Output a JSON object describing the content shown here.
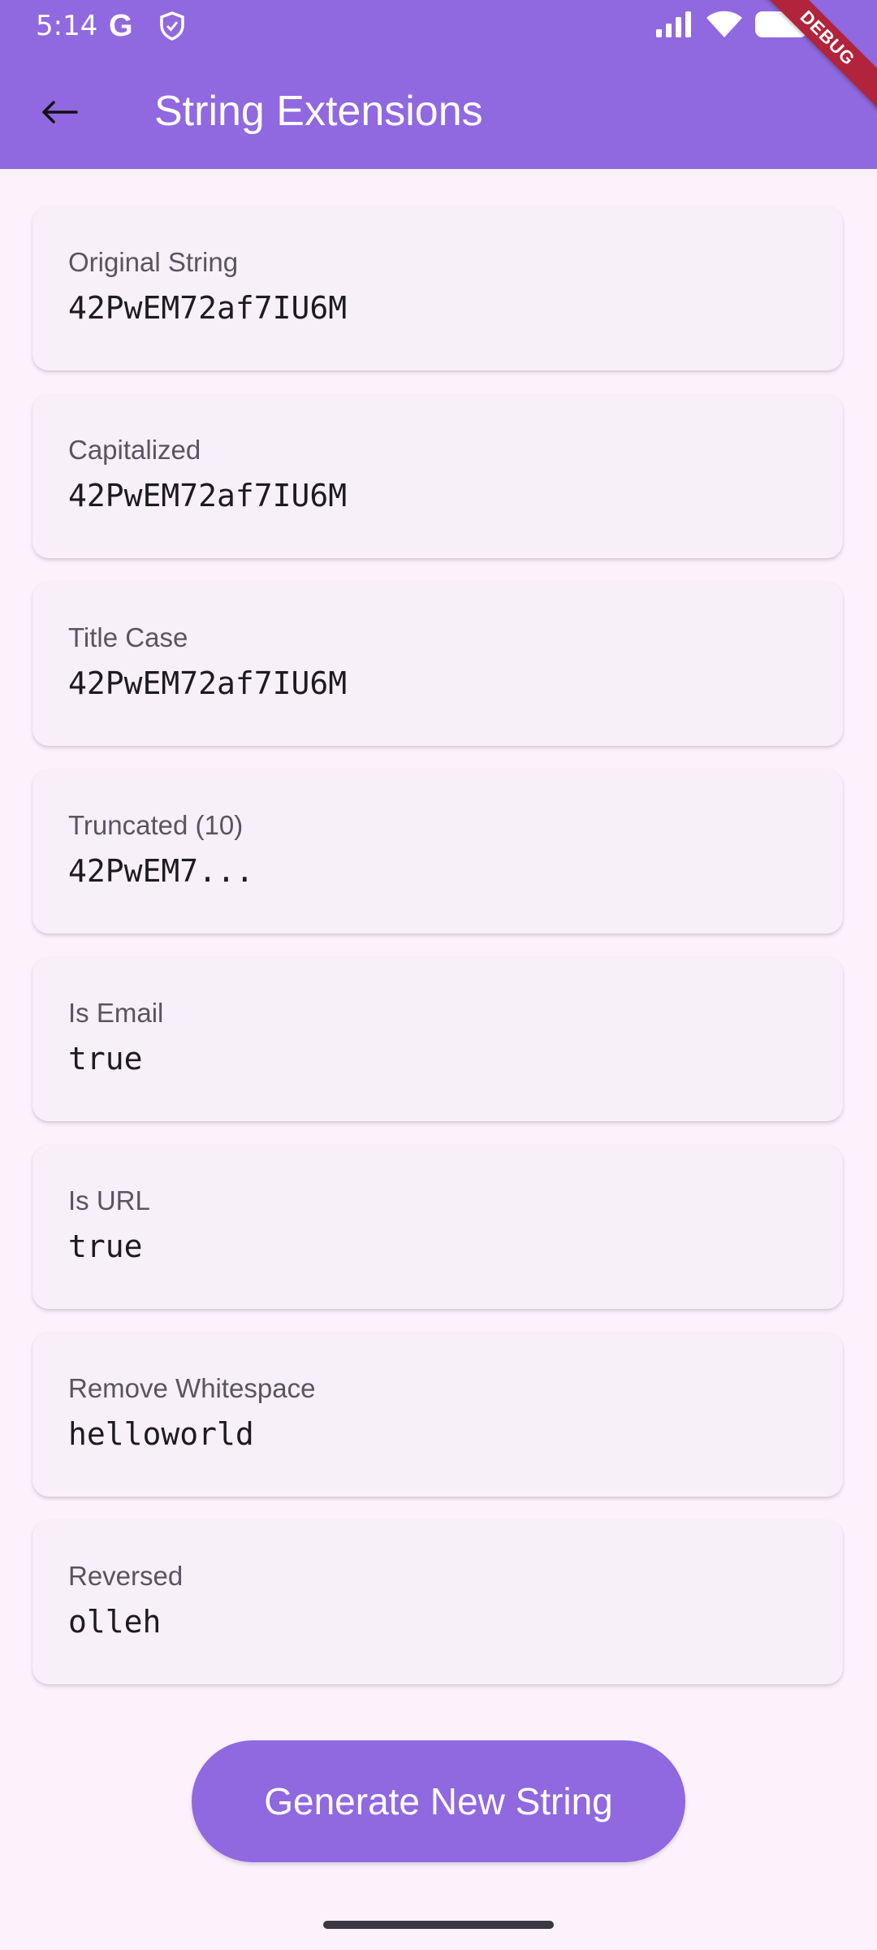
{
  "status_bar": {
    "time": "5:14",
    "google_glyph": "G",
    "icons": [
      "google-g-icon",
      "shield-icon",
      "signal-icon",
      "wifi-icon",
      "battery-icon"
    ]
  },
  "app_bar": {
    "back_glyph": "←",
    "title": "String Extensions",
    "debug_banner": "DEBUG"
  },
  "cards": [
    {
      "label": "Original String",
      "value": "42PwEM72af7IU6M"
    },
    {
      "label": "Capitalized",
      "value": "42PwEM72af7IU6M"
    },
    {
      "label": "Title Case",
      "value": "42PwEM72af7IU6M"
    },
    {
      "label": "Truncated (10)",
      "value": "42PwEM7..."
    },
    {
      "label": "Is Email",
      "value": "true"
    },
    {
      "label": "Is URL",
      "value": "true"
    },
    {
      "label": "Remove Whitespace",
      "value": "helloworld"
    },
    {
      "label": "Reversed",
      "value": "olleh"
    }
  ],
  "actions": {
    "generate_label": "Generate New String"
  },
  "colors": {
    "primary": "#9068e0",
    "background": "#fbf2fb",
    "card": "#f7f0f8",
    "debug_banner": "#b1243c"
  }
}
